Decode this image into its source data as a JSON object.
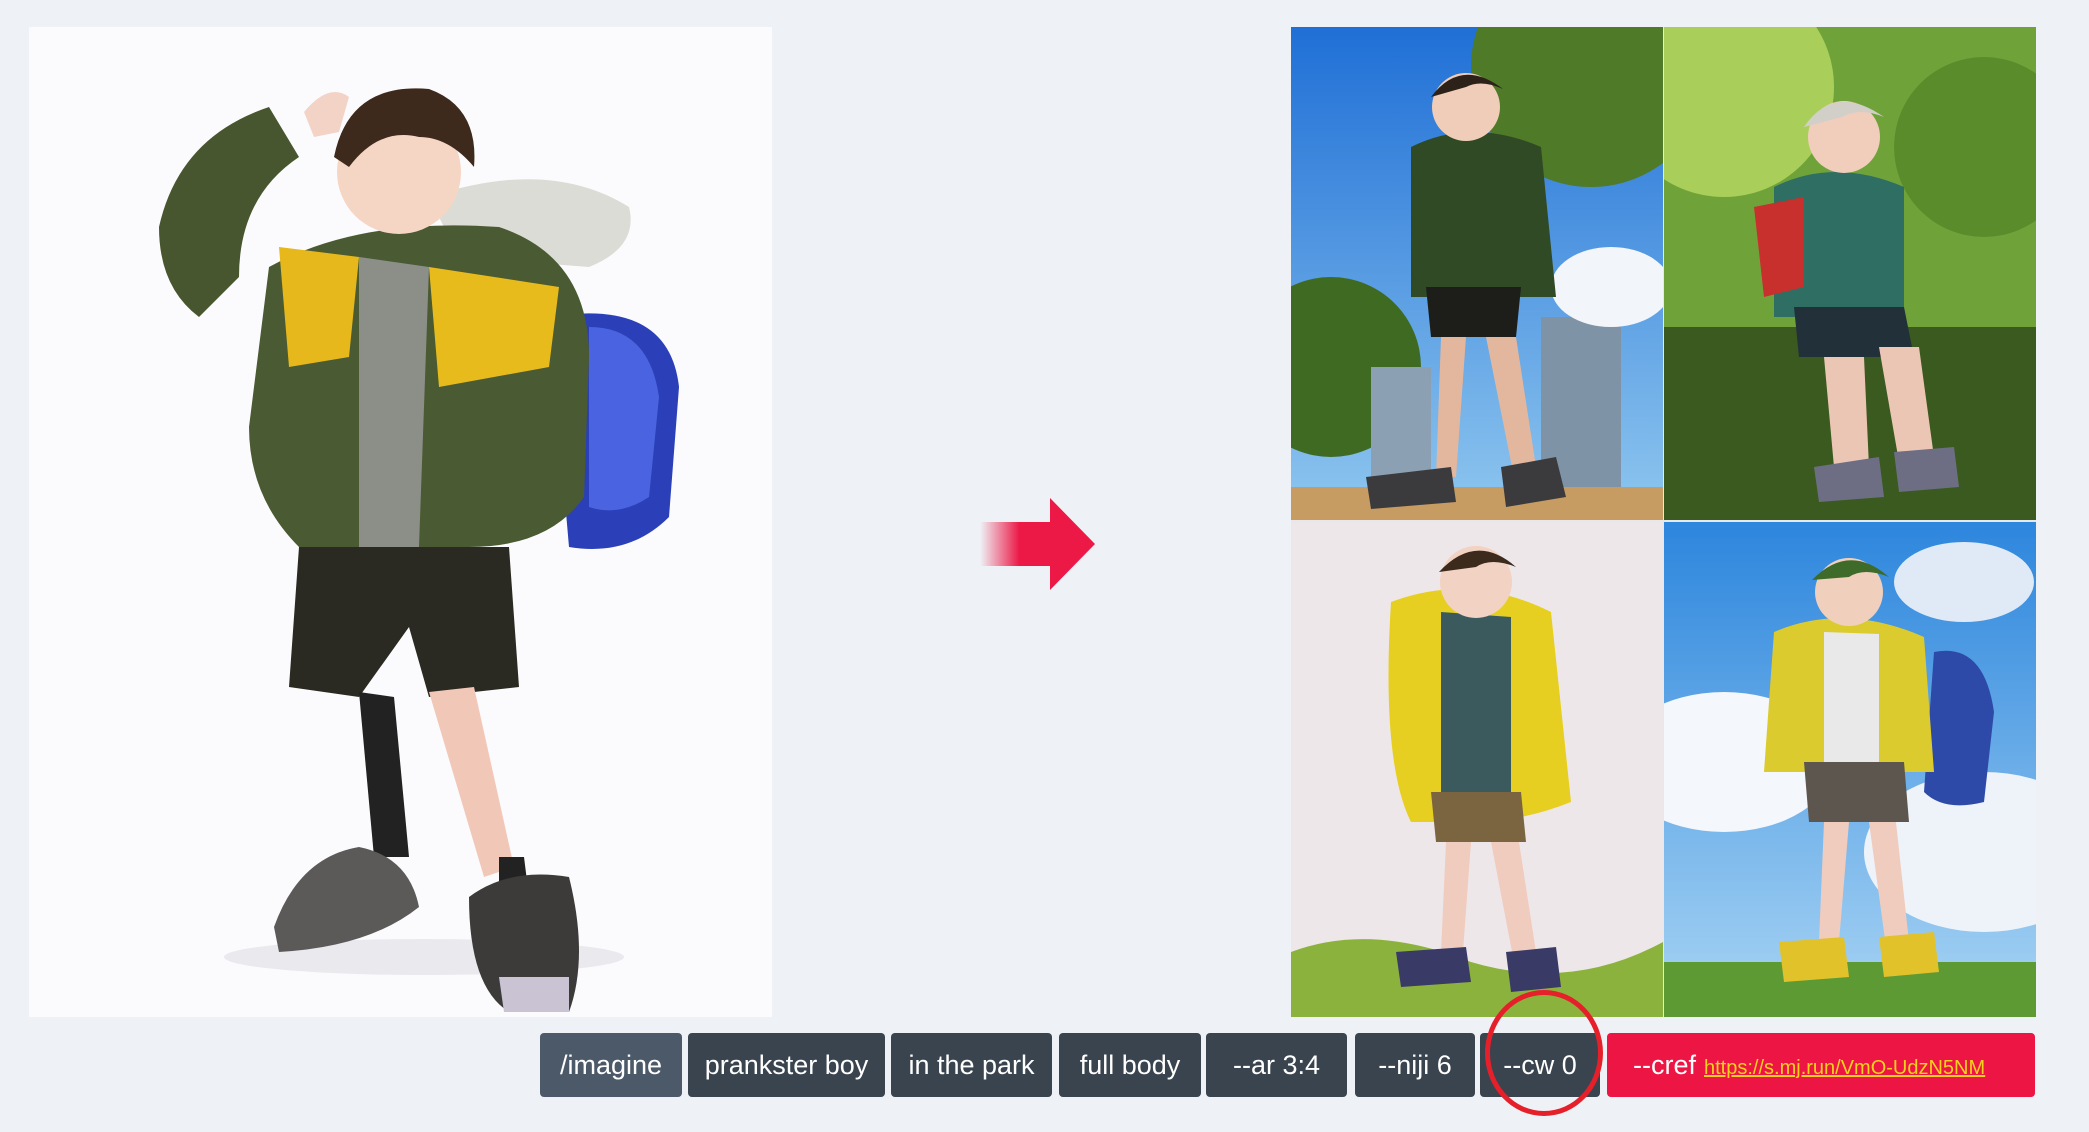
{
  "prompt_chips": [
    {
      "label": "/imagine"
    },
    {
      "label": "prankster boy"
    },
    {
      "label": "in the park"
    },
    {
      "label": "full body"
    },
    {
      "label": "--ar 3:4"
    },
    {
      "label": "--niji 6"
    },
    {
      "label": "--cw 0"
    }
  ],
  "cref_chip": {
    "label": "--cref",
    "link": "https://s.mj.run/VmO-UdzN5NM"
  },
  "colors": {
    "background": "#eef2f6",
    "chip": "#39444f",
    "cref_chip": "#ed1543",
    "cref_link": "#f3d21c",
    "arrow": "#ec1846",
    "highlight_circle": "#e5202a"
  },
  "icons": {
    "arrow": "arrow-right-icon"
  }
}
